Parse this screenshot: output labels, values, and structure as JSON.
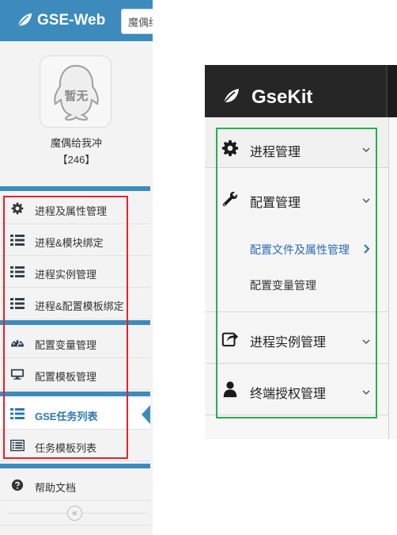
{
  "left_panel": {
    "brand": "GSE-Web",
    "search": {
      "value": "魔偶给"
    },
    "avatar_text": "暂无",
    "user": {
      "name": "魔偶给我冲",
      "count": "【246】"
    },
    "menu_group_1": [
      {
        "label": "进程及属性管理",
        "icon": "gear-icon"
      },
      {
        "label": "进程&模块绑定",
        "icon": "list-icon"
      },
      {
        "label": "进程实例管理",
        "icon": "list-icon"
      },
      {
        "label": "进程&配置模板绑定",
        "icon": "list-icon"
      }
    ],
    "menu_group_2": [
      {
        "label": "配置变量管理",
        "icon": "dashboard-icon"
      },
      {
        "label": "配置模板管理",
        "icon": "monitor-icon"
      }
    ],
    "menu_group_3": [
      {
        "label": "GSE任务列表",
        "icon": "list-icon",
        "active": true
      },
      {
        "label": "任务模板列表",
        "icon": "list-alt-icon"
      }
    ],
    "help": {
      "label": "帮助文档",
      "icon": "question-circle-icon"
    },
    "collapse_icon": "double-chevron-left-icon",
    "colors": {
      "header": "#3d8bbd",
      "active_text": "#2e77b5",
      "highlight_box": "#e2222c"
    }
  },
  "right_panel": {
    "brand": "GseKit",
    "nav": {
      "process": {
        "label": "进程管理",
        "icon": "gear-icon"
      },
      "config": {
        "label": "配置管理",
        "icon": "wrench-icon"
      },
      "config_sub": [
        {
          "label": "配置文件及属性管理",
          "active": true
        },
        {
          "label": "配置变量管理",
          "active": false
        }
      ],
      "instance": {
        "label": "进程实例管理",
        "icon": "share-icon"
      },
      "terminal": {
        "label": "终端授权管理",
        "icon": "user-icon"
      }
    },
    "colors": {
      "header": "#262626",
      "active_text": "#2a6db4",
      "highlight_box": "#22b14c"
    }
  }
}
